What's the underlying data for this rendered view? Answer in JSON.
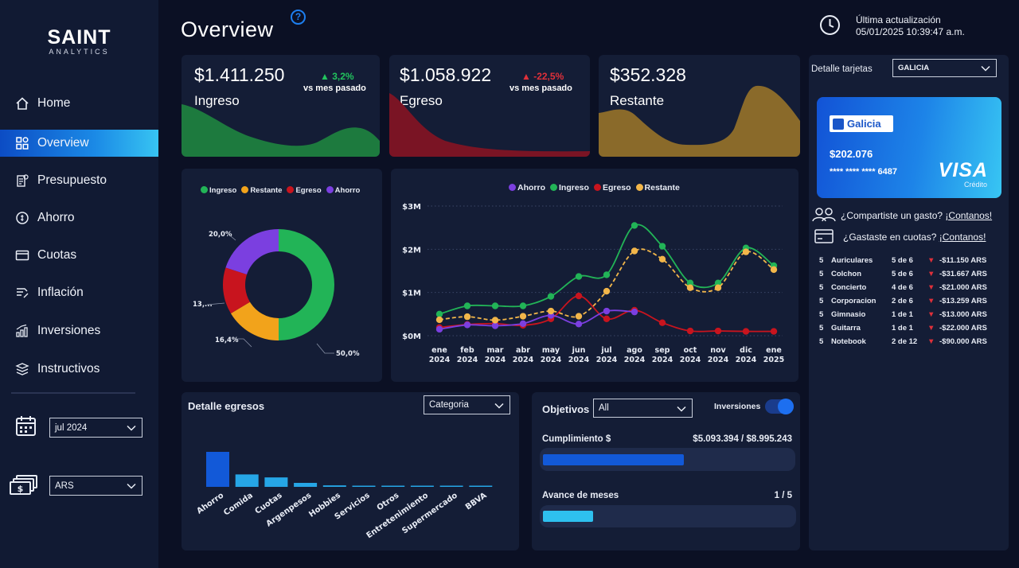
{
  "brand": {
    "name": "SAINT",
    "tagline": "ANALYTICS"
  },
  "nav": {
    "items": [
      {
        "label": "Home",
        "icon": "home-icon"
      },
      {
        "label": "Overview",
        "icon": "overview-icon",
        "active": true
      },
      {
        "label": "Presupuesto",
        "icon": "budget-icon"
      },
      {
        "label": "Ahorro",
        "icon": "savings-icon"
      },
      {
        "label": "Cuotas",
        "icon": "card-icon"
      },
      {
        "label": "Inflación",
        "icon": "inflation-icon"
      },
      {
        "label": "Inversiones",
        "icon": "investments-icon"
      },
      {
        "label": "Instructivos",
        "icon": "stack-icon"
      }
    ]
  },
  "filters": {
    "month": "jul 2024",
    "currency": "ARS"
  },
  "header": {
    "title": "Overview",
    "help": "?",
    "last_update_label": "Última actualización",
    "last_update_value": "05/01/2025 10:39:47 a.m."
  },
  "kpis": [
    {
      "value": "$1.411.250",
      "label": "Ingreso",
      "delta": "▲ 3,2%",
      "delta_color": "#22c35e",
      "sub": "vs mes pasado",
      "color": "#1d7a3e"
    },
    {
      "value": "$1.058.922",
      "label": "Egreso",
      "delta": "▲ -22,5%",
      "delta_color": "#e0303a",
      "sub": "vs mes pasado",
      "color": "#7a1424"
    },
    {
      "value": "$352.328",
      "label": "Restante",
      "delta": "",
      "delta_color": "",
      "sub": "",
      "color": "#8a6a2a"
    }
  ],
  "donut": {
    "legend": [
      "Ingreso",
      "Restante",
      "Egreso",
      "Ahorro"
    ],
    "labels": {
      "ahorro": "20,0%",
      "egreso": "13,...",
      "restante": "16,4%",
      "ingreso": "50,0%"
    }
  },
  "line": {
    "legend": [
      "Ahorro",
      "Ingreso",
      "Egreso",
      "Restante"
    ],
    "y_ticks": [
      "$3M",
      "$2M",
      "$1M",
      "$0M"
    ],
    "x_months": [
      "ene",
      "feb",
      "mar",
      "abr",
      "may",
      "jun",
      "jul",
      "ago",
      "sep",
      "oct",
      "nov",
      "dic",
      "ene"
    ],
    "x_years": [
      "2024",
      "2024",
      "2024",
      "2024",
      "2024",
      "2024",
      "2024",
      "2024",
      "2024",
      "2024",
      "2024",
      "2024",
      "2025"
    ]
  },
  "egresos": {
    "title": "Detalle egresos",
    "dropdown": "Categoria",
    "categories": [
      "Ahorro",
      "Comida",
      "Cuotas",
      "Argenpesos",
      "Hobbies",
      "Servicios",
      "Otros",
      "Entretenimiento",
      "Supermercado",
      "BBVA"
    ]
  },
  "objetivos": {
    "title": "Objetivos",
    "dropdown": "All",
    "toggle_label": "Inversiones",
    "cumplimiento_label": "Cumplimiento $",
    "cumplimiento_value": "$5.093.394 / $8.995.243",
    "cumplimiento_fraction": 0.566,
    "avance_label": "Avance de meses",
    "avance_value": "1 / 5",
    "avance_fraction": 0.2
  },
  "tarjetas": {
    "label": "Detalle tarjetas",
    "bank": "GALICIA",
    "card_bank_name": "Galicia",
    "card_amount": "$202.076",
    "card_number": "**** **** **** 6487",
    "card_brand": "VISA",
    "card_type": "Crédito",
    "share_text": "¿Compartiste un gasto? ",
    "share_link": "¡Contanos!",
    "cuotas_text": "¿Gastaste en cuotas? ",
    "cuotas_link": "¡Contanos!"
  },
  "installments": [
    {
      "n": "5",
      "name": "Auriculares",
      "cuota": "5 de 6",
      "amount": "-$11.150 ARS"
    },
    {
      "n": "5",
      "name": "Colchon",
      "cuota": "5 de 6",
      "amount": "-$31.667 ARS"
    },
    {
      "n": "5",
      "name": "Concierto",
      "cuota": "4 de 6",
      "amount": "-$21.000 ARS"
    },
    {
      "n": "5",
      "name": "Corporacion",
      "cuota": "2 de 6",
      "amount": "-$13.259 ARS"
    },
    {
      "n": "5",
      "name": "Gimnasio",
      "cuota": "1 de 1",
      "amount": "-$13.000 ARS"
    },
    {
      "n": "5",
      "name": "Guitarra",
      "cuota": "1 de 1",
      "amount": "-$22.000 ARS"
    },
    {
      "n": "5",
      "name": "Notebook",
      "cuota": "2 de 12",
      "amount": "-$90.000 ARS"
    }
  ],
  "chart_data": [
    {
      "type": "pie",
      "title": "",
      "categories": [
        "Ingreso",
        "Restante",
        "Egreso",
        "Ahorro"
      ],
      "values": [
        50.0,
        16.4,
        13.6,
        20.0
      ],
      "colors": [
        "#22b457",
        "#f2a31b",
        "#c8141e",
        "#7b3fe0"
      ],
      "legend": "top"
    },
    {
      "type": "line",
      "title": "",
      "x": [
        "ene 2024",
        "feb 2024",
        "mar 2024",
        "abr 2024",
        "may 2024",
        "jun 2024",
        "jul 2024",
        "ago 2024",
        "sep 2024",
        "oct 2024",
        "nov 2024",
        "dic 2024",
        "ene 2025"
      ],
      "ylim": [
        0,
        3000000
      ],
      "legend": "top",
      "grid": true,
      "series": [
        {
          "name": "Ahorro",
          "color": "#7b3fe0",
          "values": [
            150000,
            250000,
            230000,
            280000,
            470000,
            270000,
            570000,
            550000,
            null,
            null,
            null,
            null,
            null
          ]
        },
        {
          "name": "Ingreso",
          "color": "#22b457",
          "values": [
            500000,
            690000,
            690000,
            690000,
            910000,
            1370000,
            1410000,
            2550000,
            2070000,
            1220000,
            1220000,
            2030000,
            1620000
          ]
        },
        {
          "name": "Egreso",
          "color": "#c8141e",
          "values": [
            190000,
            260000,
            280000,
            240000,
            390000,
            920000,
            390000,
            590000,
            300000,
            110000,
            110000,
            100000,
            100000
          ]
        },
        {
          "name": "Restante",
          "color": "#f2b64a",
          "dashed": true,
          "values": [
            370000,
            440000,
            360000,
            450000,
            570000,
            450000,
            1030000,
            1960000,
            1770000,
            1110000,
            1110000,
            1940000,
            1530000
          ]
        }
      ]
    },
    {
      "type": "bar",
      "title": "Detalle egresos",
      "categories": [
        "Ahorro",
        "Comida",
        "Cuotas",
        "Argenpesos",
        "Hobbies",
        "Servicios",
        "Otros",
        "Entretenimiento",
        "Supermercado",
        "BBVA"
      ],
      "values": [
        352000,
        125000,
        95000,
        40000,
        15000,
        8000,
        8000,
        8000,
        8000,
        8000
      ],
      "colors": [
        "#1259d8",
        "#26a6e6",
        "#26a6e6",
        "#26a6e6",
        "#26a6e6",
        "#26a6e6",
        "#26a6e6",
        "#26a6e6",
        "#26a6e6",
        "#26a6e6"
      ]
    }
  ]
}
